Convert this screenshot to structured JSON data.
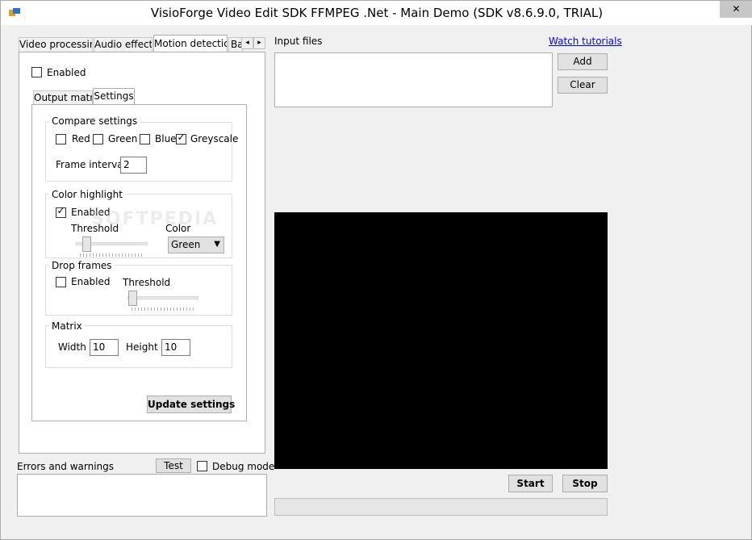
{
  "window": {
    "title": "VisioForge Video Edit SDK FFMPEG .Net - Main Demo (SDK v8.6.9.0, TRIAL)",
    "close_glyph": "✕"
  },
  "tabs": [
    {
      "label": "Video processing",
      "active": false
    },
    {
      "label": "Audio effects",
      "active": false
    },
    {
      "label": "Motion detection",
      "active": true
    },
    {
      "label": "Ba",
      "active": false
    }
  ],
  "tab_scroll": {
    "left": "◂",
    "right": "▸"
  },
  "motion": {
    "enabled_label": "Enabled",
    "enabled_checked": false,
    "subtabs": [
      {
        "label": "Output matrix",
        "active": false
      },
      {
        "label": "Settings",
        "active": true
      }
    ],
    "compare": {
      "title": "Compare settings",
      "red": "Red",
      "green": "Green",
      "blue": "Blue",
      "greyscale": "Greyscale",
      "greyscale_checked": true,
      "frame_interval_label": "Frame interval",
      "frame_interval_value": "2"
    },
    "highlight": {
      "title": "Color highlight",
      "enabled_label": "Enabled",
      "enabled_checked": true,
      "threshold_label": "Threshold",
      "color_label": "Color",
      "color_value": "Green",
      "threshold_level": 0.1
    },
    "drop": {
      "title": "Drop frames",
      "enabled_label": "Enabled",
      "enabled_checked": false,
      "threshold_label": "Threshold",
      "threshold_level": 0.0
    },
    "matrix": {
      "title": "Matrix",
      "width_label": "Width",
      "width_value": "10",
      "height_label": "Height",
      "height_value": "10"
    },
    "update_button": "Update settings"
  },
  "errors": {
    "label": "Errors and warnings",
    "test_button": "Test",
    "debug_label": "Debug mode",
    "debug_checked": false
  },
  "input": {
    "label": "Input files",
    "watch_link": "Watch tutorials",
    "add_button": "Add",
    "clear_button": "Clear"
  },
  "playback": {
    "start_button": "Start",
    "stop_button": "Stop",
    "progress": 0
  },
  "watermark": "SOFTPEDIA",
  "check_glyph": "✓",
  "dropdown_glyph": "▼",
  "colors": {
    "window_bg": "#f0f0f0",
    "preview_bg": "#000000",
    "link": "#0000ff"
  }
}
